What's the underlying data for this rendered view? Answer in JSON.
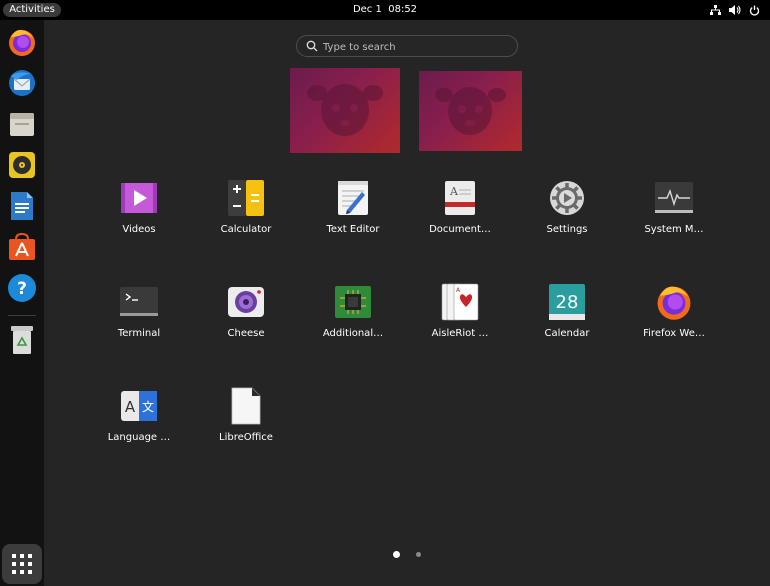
{
  "topbar": {
    "activities_label": "Activities",
    "date": "Dec 1",
    "time": "08:52",
    "tray_icons": [
      "network-icon",
      "volume-icon",
      "power-icon"
    ]
  },
  "dock": {
    "items": [
      {
        "name": "Firefox",
        "icon": "firefox-icon"
      },
      {
        "name": "Thunderbird Mail",
        "icon": "thunderbird-icon"
      },
      {
        "name": "Files",
        "icon": "files-icon"
      },
      {
        "name": "Rhythmbox",
        "icon": "rhythmbox-icon"
      },
      {
        "name": "LibreOffice Writer",
        "icon": "writer-icon"
      },
      {
        "name": "Ubuntu Software",
        "icon": "software-icon"
      },
      {
        "name": "Help",
        "icon": "help-icon"
      },
      {
        "name": "Trash",
        "icon": "trash-icon"
      }
    ],
    "show_apps": {
      "icon": "app-grid-icon"
    }
  },
  "search": {
    "placeholder": "Type to search"
  },
  "apps": [
    {
      "label": "Videos",
      "icon": "videos-icon"
    },
    {
      "label": "Calculator",
      "icon": "calculator-icon"
    },
    {
      "label": "Text Editor",
      "icon": "text-editor-icon"
    },
    {
      "label": "Document…",
      "icon": "document-viewer-icon"
    },
    {
      "label": "Settings",
      "icon": "settings-icon"
    },
    {
      "label": "System M…",
      "icon": "system-monitor-icon"
    },
    {
      "label": "Terminal",
      "icon": "terminal-icon"
    },
    {
      "label": "Cheese",
      "icon": "cheese-icon"
    },
    {
      "label": "Additional…",
      "icon": "additional-drivers-icon"
    },
    {
      "label": "AisleRiot …",
      "icon": "aisleriot-icon"
    },
    {
      "label": "Calendar",
      "icon": "calendar-icon",
      "day": "28"
    },
    {
      "label": "Firefox We…",
      "icon": "firefox-icon"
    },
    {
      "label": "Language …",
      "icon": "language-support-icon"
    },
    {
      "label": "LibreOffice",
      "icon": "libreoffice-icon"
    }
  ],
  "pager": {
    "pages": 2,
    "current": 1
  },
  "colors": {
    "accent": "#e95420",
    "panel": "#000000",
    "dock": "#121212",
    "overview": "#252525"
  }
}
